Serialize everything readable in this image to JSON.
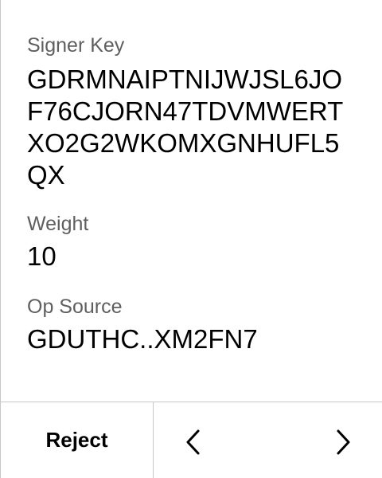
{
  "fields": {
    "signer_key": {
      "label": "Signer Key",
      "value": "GDRMNAIPTNIJWJSL6JOF76CJORN47TDVMWERTXO2G2WKOMXGNHUFL5QX"
    },
    "weight": {
      "label": "Weight",
      "value": "10"
    },
    "op_source": {
      "label": "Op Source",
      "value": "GDUTHC..XM2FN7"
    }
  },
  "footer": {
    "reject_label": "Reject",
    "prev_icon": "chevron-left-icon",
    "next_icon": "chevron-right-icon"
  }
}
